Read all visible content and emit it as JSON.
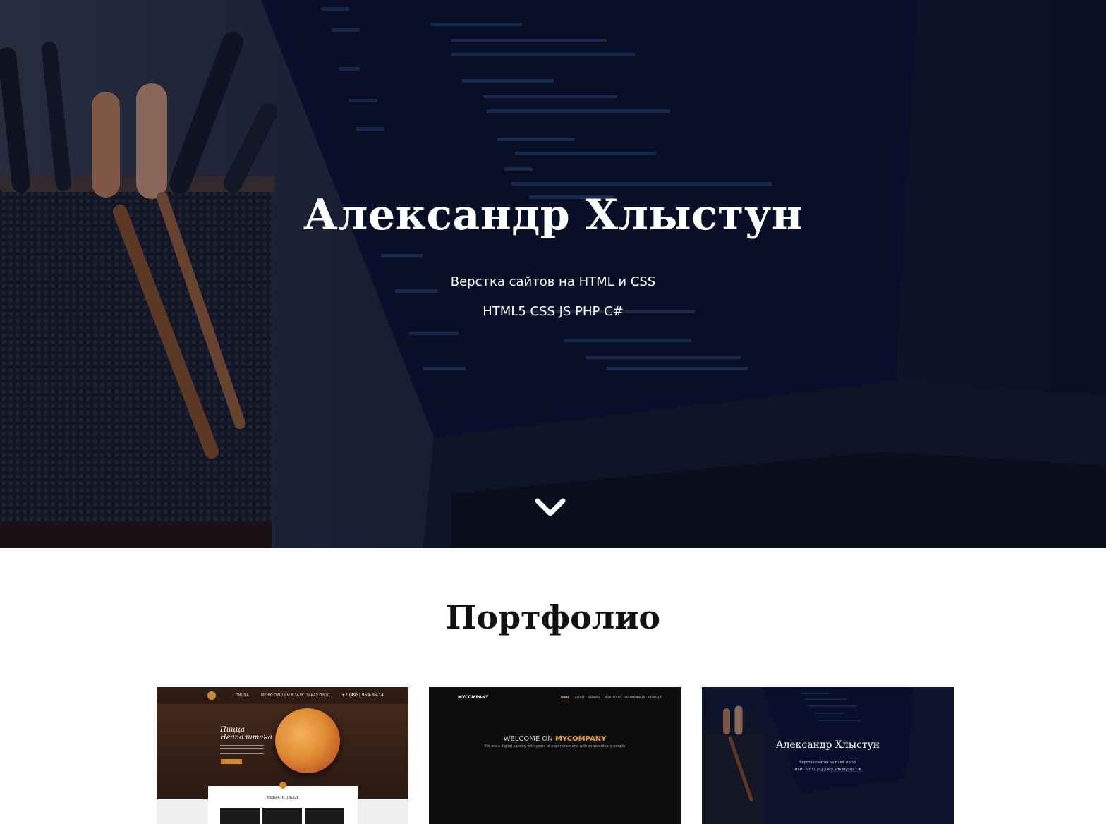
{
  "hero": {
    "title": "Александр Хлыстун",
    "subtitle_line1": "Верстка сайтов на HTML и CSS",
    "subtitle_line2": "HTML5 CSS JS PHP C#",
    "scroll_icon": "chevron-down-icon"
  },
  "portfolio": {
    "title": "Портфолио",
    "items": [
      {
        "head_line1": "Пицца",
        "head_line2": "Неаполитана",
        "nav": [
          "ПИЦЦА",
          "МЕНЮ ПИЦЦ",
          "МЫ В ЗАЛЕ",
          "ЗАКАЗ ПИЦЦ"
        ],
        "phone": "+7 (495) 959-36-14",
        "panel_title": "ВЫБРАТЬ ПИЦЦУ"
      },
      {
        "brand": "MYCOMPANY",
        "nav": [
          "HOME",
          "ABOUT",
          "SERVICE",
          "PORTFOLIO",
          "TESTIMONIALS",
          "CONTACT"
        ],
        "welcome_prefix": "WELCOME ON",
        "welcome_brand": "MYCOMPANY",
        "tagline": "We are a digital agency with years of experience and with extraordinary people"
      },
      {
        "title": "Александр Хлыстун",
        "sub1": "Верстка сайтов на HTML и CSS",
        "sub2": "HTML 5 CSS JS jQuery PHP MySQL C#"
      }
    ]
  },
  "colors": {
    "accent_orange": "#f0a31c",
    "hero_dark": "#10162a"
  }
}
